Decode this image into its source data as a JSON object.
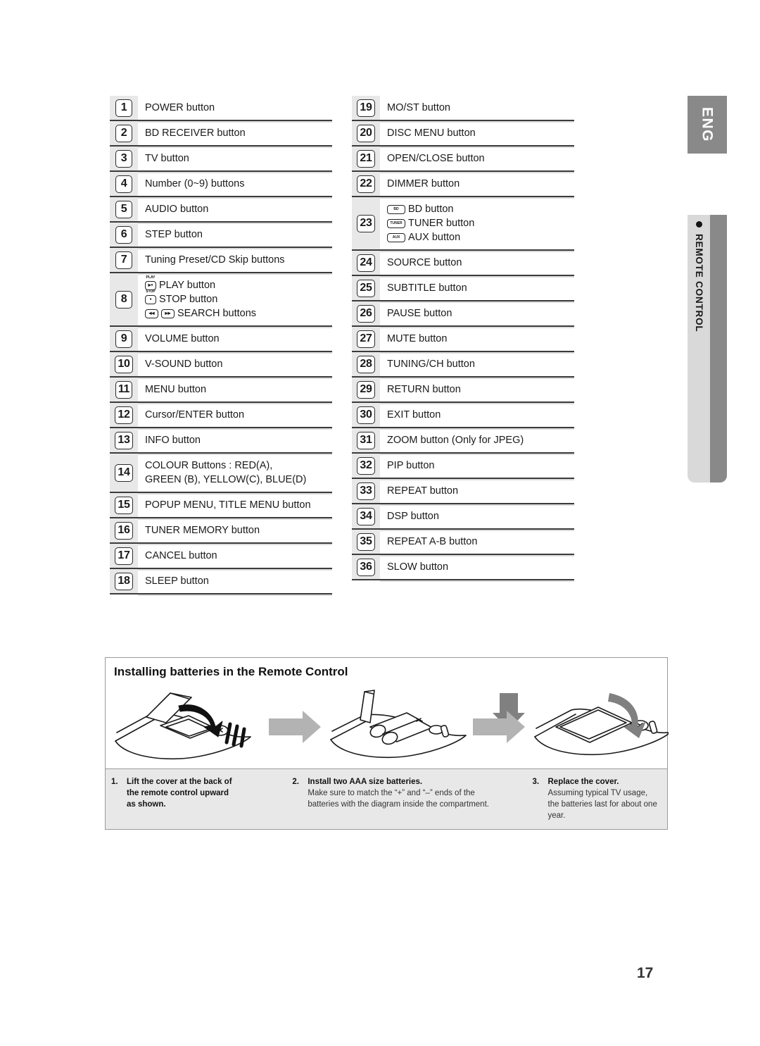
{
  "side_tabs": {
    "language": "ENG",
    "section": "REMOTE CONTROL",
    "bullet_icon": "bullet-dot-icon"
  },
  "page_number": "17",
  "button_table": {
    "left": [
      {
        "num": "1",
        "lines": [
          {
            "text": "POWER button"
          }
        ]
      },
      {
        "num": "2",
        "lines": [
          {
            "text": "BD RECEIVER button"
          }
        ]
      },
      {
        "num": "3",
        "lines": [
          {
            "text": "TV button"
          }
        ]
      },
      {
        "num": "4",
        "lines": [
          {
            "text": "Number (0~9) buttons"
          }
        ]
      },
      {
        "num": "5",
        "lines": [
          {
            "text": "AUDIO button"
          }
        ]
      },
      {
        "num": "6",
        "lines": [
          {
            "text": "STEP button"
          }
        ]
      },
      {
        "num": "7",
        "lines": [
          {
            "text": "Tuning Preset/CD Skip buttons"
          }
        ]
      },
      {
        "num": "8",
        "lines": [
          {
            "icon": "play-key-icon",
            "icon_cap": "PLAY",
            "icon_glyph": "▸•",
            "text": "PLAY button"
          },
          {
            "icon": "stop-key-icon",
            "icon_cap": "STOP",
            "icon_glyph": "▪",
            "text": "STOP button"
          },
          {
            "icon": "search-keys-icon",
            "icon_glyph": "◂◂",
            "icon_glyph2": "▸▸",
            "text": "SEARCH buttons"
          }
        ]
      },
      {
        "num": "9",
        "lines": [
          {
            "text": "VOLUME button"
          }
        ]
      },
      {
        "num": "10",
        "lines": [
          {
            "text": "V-SOUND button"
          }
        ]
      },
      {
        "num": "11",
        "lines": [
          {
            "text": "MENU button"
          }
        ]
      },
      {
        "num": "12",
        "lines": [
          {
            "text": "Cursor/ENTER button"
          }
        ]
      },
      {
        "num": "13",
        "lines": [
          {
            "text": "INFO button"
          }
        ]
      },
      {
        "num": "14",
        "lines": [
          {
            "text": "COLOUR Buttons : RED(A),"
          },
          {
            "text": "GREEN (B), YELLOW(C), BLUE(D)"
          }
        ]
      },
      {
        "num": "15",
        "lines": [
          {
            "text": "POPUP MENU, TITLE MENU button"
          }
        ]
      },
      {
        "num": "16",
        "lines": [
          {
            "text": "TUNER MEMORY button"
          }
        ]
      },
      {
        "num": "17",
        "lines": [
          {
            "text": "CANCEL button"
          }
        ]
      },
      {
        "num": "18",
        "lines": [
          {
            "text": "SLEEP button"
          }
        ]
      }
    ],
    "right": [
      {
        "num": "19",
        "lines": [
          {
            "text": "MO/ST button"
          }
        ]
      },
      {
        "num": "20",
        "lines": [
          {
            "text": "DISC MENU button"
          }
        ]
      },
      {
        "num": "21",
        "lines": [
          {
            "text": "OPEN/CLOSE button"
          }
        ]
      },
      {
        "num": "22",
        "lines": [
          {
            "text": "DIMMER button"
          }
        ]
      },
      {
        "num": "23",
        "lines": [
          {
            "icon": "bd-key-icon",
            "icon_label": "BD",
            "text": "BD button"
          },
          {
            "icon": "tuner-key-icon",
            "icon_label": "TUNER",
            "text": "TUNER button"
          },
          {
            "icon": "aux-key-icon",
            "icon_label": "AUX",
            "text": "AUX button"
          }
        ]
      },
      {
        "num": "24",
        "lines": [
          {
            "text": "SOURCE button"
          }
        ]
      },
      {
        "num": "25",
        "lines": [
          {
            "text": "SUBTITLE button"
          }
        ]
      },
      {
        "num": "26",
        "lines": [
          {
            "text": "PAUSE button"
          }
        ]
      },
      {
        "num": "27",
        "lines": [
          {
            "text": "MUTE button"
          }
        ]
      },
      {
        "num": "28",
        "lines": [
          {
            "text": "TUNING/CH button"
          }
        ]
      },
      {
        "num": "29",
        "lines": [
          {
            "text": "RETURN button"
          }
        ]
      },
      {
        "num": "30",
        "lines": [
          {
            "text": "EXIT button"
          }
        ]
      },
      {
        "num": "31",
        "lines": [
          {
            "text": "ZOOM button (Only for JPEG)"
          }
        ]
      },
      {
        "num": "32",
        "lines": [
          {
            "text": "PIP button"
          }
        ]
      },
      {
        "num": "33",
        "lines": [
          {
            "text": "REPEAT button"
          }
        ]
      },
      {
        "num": "34",
        "lines": [
          {
            "text": "DSP button"
          }
        ]
      },
      {
        "num": "35",
        "lines": [
          {
            "text": "REPEAT A-B button"
          }
        ]
      },
      {
        "num": "36",
        "lines": [
          {
            "text": "SLOW button"
          }
        ]
      }
    ]
  },
  "battery_section": {
    "title": "Installing batteries in the Remote Control",
    "figures": [
      {
        "name": "remote-cover-open-figure"
      },
      {
        "name": "arrow-right-icon"
      },
      {
        "name": "remote-batteries-insert-figure"
      },
      {
        "name": "arrow-right-icon"
      },
      {
        "name": "remote-cover-replace-figure"
      }
    ],
    "steps": [
      {
        "num": "1.",
        "heading_lines": [
          "Lift the cover at the back of",
          "the remote control upward",
          "as shown."
        ],
        "body_lines": []
      },
      {
        "num": "2.",
        "heading_lines": [
          "Install two AAA size batteries."
        ],
        "body_lines": [
          "Make sure to match the “+” and “–” ends of the",
          "batteries with the diagram inside the compartment."
        ]
      },
      {
        "num": "3.",
        "heading_lines": [
          "Replace the cover."
        ],
        "body_lines": [
          "Assuming typical TV usage,",
          "the batteries last for about one",
          "year."
        ]
      }
    ]
  },
  "colors": {
    "badge_column": "#e8e8e8",
    "divider": "#3b3b3b",
    "tab_gray": "#898989",
    "tab_light": "#d9d9d9",
    "caption_strip": "#e8e8e8",
    "arrow_gray": "#b3b3b3"
  }
}
